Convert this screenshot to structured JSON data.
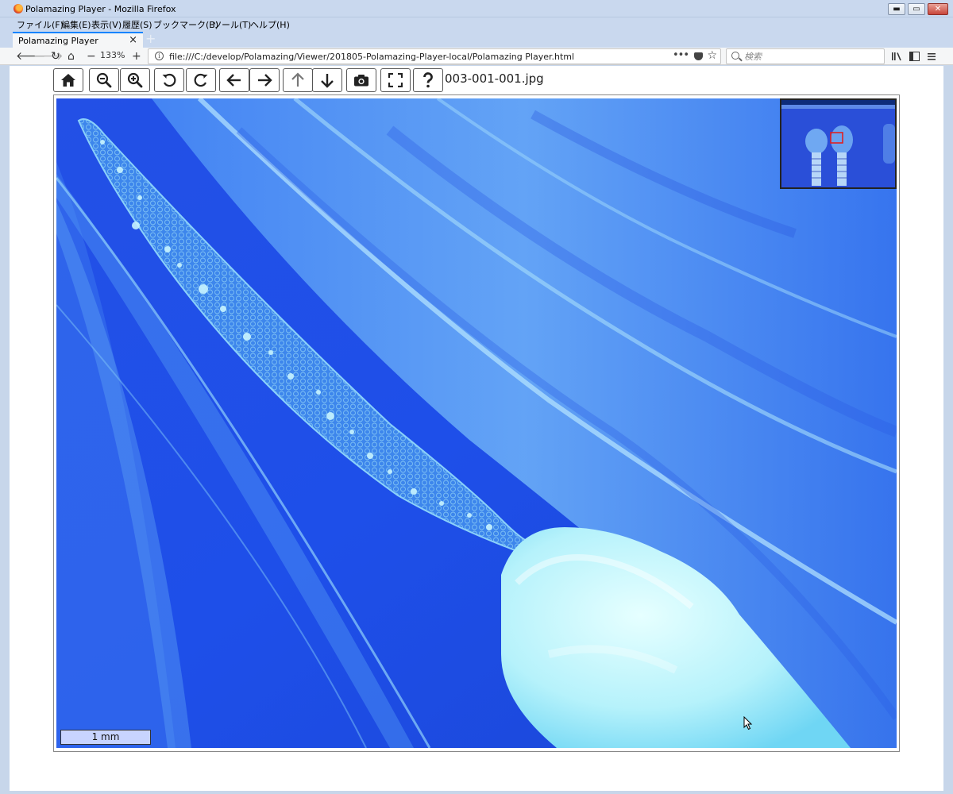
{
  "window": {
    "title": "Polamazing Player - Mozilla Firefox",
    "menu": [
      "ファイル(F)",
      "編集(E)",
      "表示(V)",
      "履歴(S)",
      "ブックマーク(B)",
      "ツール(T)",
      "ヘルプ(H)"
    ]
  },
  "tab": {
    "title": "Polamazing Player"
  },
  "navigation": {
    "zoom_level": "133%",
    "url": "file:///C:/develop/Polamazing/Viewer/201805-Polamazing-Player-local/Polamazing Player.html",
    "search_placeholder": "検索"
  },
  "toolbar": {
    "buttons": [
      "home-icon",
      "zoom-out-icon",
      "zoom-in-icon",
      "rotate-left-icon",
      "rotate-right-icon",
      "arrow-left-icon",
      "arrow-right-icon",
      "arrow-up-icon",
      "arrow-down-icon",
      "camera-icon",
      "fullscreen-icon",
      "help-icon"
    ]
  },
  "viewer": {
    "filename": "003-001-001.jpg",
    "scale_label": "1 mm"
  },
  "colors": {
    "image_background": "#1d52e8",
    "accent": "#0a84ff"
  }
}
